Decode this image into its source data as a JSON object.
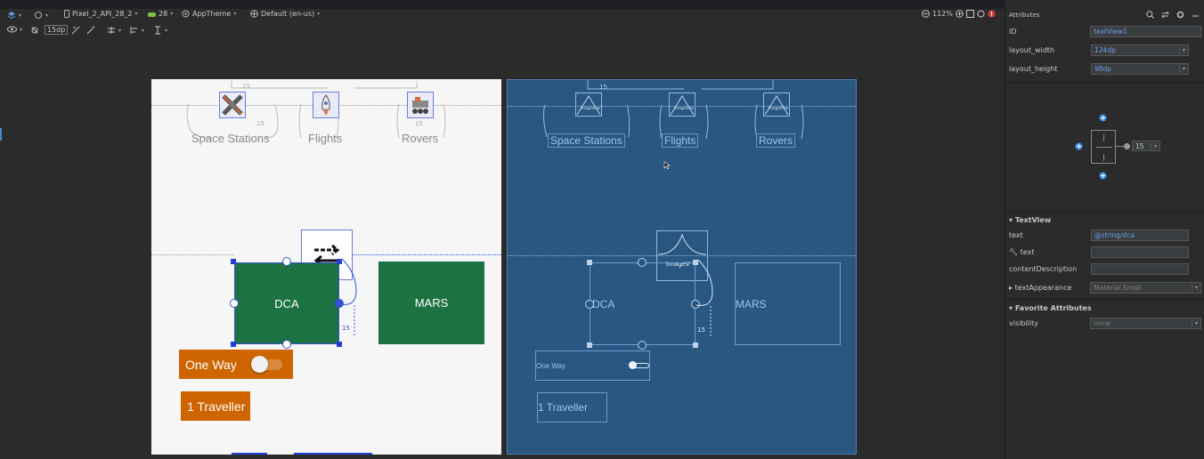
{
  "toolbar": {
    "device": "Pixel_2_API_28_2",
    "api": "28",
    "theme": "AppTheme",
    "locale": "Default (en-us)",
    "zoom": "112%",
    "margin": "15dp"
  },
  "design": {
    "nav_labels": [
      "Space Stations",
      "Flights",
      "Rovers"
    ],
    "dca_label": "DCA",
    "mars_label": "MARS",
    "one_way_label": "One Way",
    "traveller_label": "1 Traveller",
    "margin_15": "15"
  },
  "blueprint": {
    "nav_labels": [
      "Space Stations",
      "Flights",
      "Rovers"
    ],
    "imageview_label": "ImageView",
    "image_tag": "ImageV",
    "dca_label": "DCA",
    "mars_label": "MARS",
    "one_way_label": "One Way",
    "traveller_label": "1 Traveller",
    "margin_15": "15"
  },
  "panel": {
    "title": "Attributes",
    "id_label": "ID",
    "id_value": "textView1",
    "layout_width_label": "layout_width",
    "layout_width_value": "124dp",
    "layout_height_label": "layout_height",
    "layout_height_value": "98dp",
    "constraint_margin": "15",
    "textview_section": "TextView",
    "text_label": "text",
    "text_value": "@string/dca",
    "tools_text_label": "text",
    "content_description_label": "contentDescription",
    "text_appearance_label": "textAppearance",
    "text_appearance_value": "Material.Small",
    "favorite_section": "Favorite Attributes",
    "visibility_label": "visibility",
    "visibility_value": "none"
  },
  "colors": {
    "accent": "#6aa0e5",
    "green": "#1c7240",
    "orange": "#cf6500",
    "blueprint": "#295782"
  }
}
